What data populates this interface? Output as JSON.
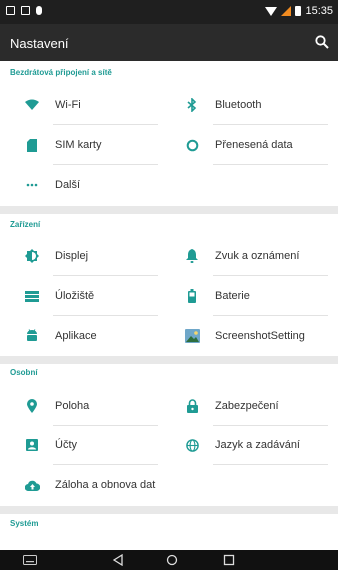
{
  "status_bar": {
    "time": "15:35"
  },
  "app_bar": {
    "title": "Nastavení"
  },
  "sections": {
    "wireless": {
      "title": "Bezdrátová připojení a sítě",
      "items": [
        {
          "label": "Wi‑Fi",
          "icon": "wifi-icon"
        },
        {
          "label": "Bluetooth",
          "icon": "bluetooth-icon"
        },
        {
          "label": "SIM karty",
          "icon": "sim-card-icon"
        },
        {
          "label": "Přenesená data",
          "icon": "data-usage-icon"
        },
        {
          "label": "Další",
          "icon": "more-dots-icon"
        }
      ]
    },
    "device": {
      "title": "Zařízení",
      "items": [
        {
          "label": "Displej",
          "icon": "display-icon"
        },
        {
          "label": "Zvuk a oznámení",
          "icon": "bell-icon"
        },
        {
          "label": "Úložiště",
          "icon": "storage-icon"
        },
        {
          "label": "Baterie",
          "icon": "battery-icon"
        },
        {
          "label": "Aplikace",
          "icon": "android-icon"
        },
        {
          "label": "ScreenshotSetting",
          "icon": "screenshot-app-icon"
        }
      ]
    },
    "personal": {
      "title": "Osobní",
      "items": [
        {
          "label": "Poloha",
          "icon": "location-pin-icon"
        },
        {
          "label": "Zabezpečení",
          "icon": "lock-icon"
        },
        {
          "label": "Účty",
          "icon": "account-icon"
        },
        {
          "label": "Jazyk a zadávání",
          "icon": "globe-icon"
        },
        {
          "label": "Záloha a obnova dat",
          "icon": "cloud-upload-icon"
        }
      ]
    },
    "system": {
      "title": "Systém"
    }
  },
  "colors": {
    "accent": "#1f9b94",
    "appbar": "#2b2b2b",
    "statusbar": "#1f1f1f"
  }
}
